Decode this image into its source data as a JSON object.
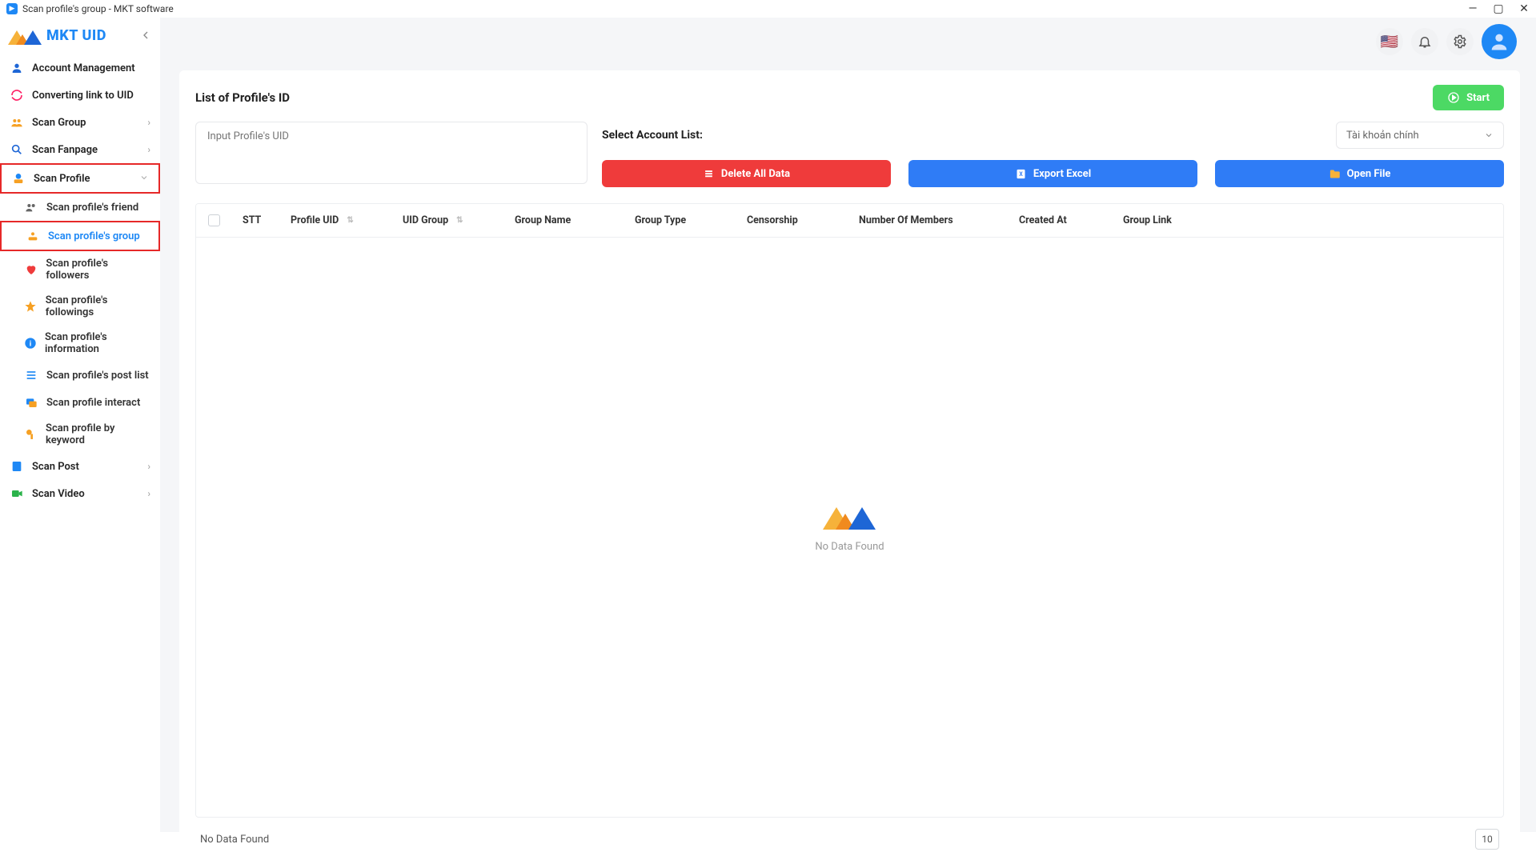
{
  "window": {
    "title": "Scan profile's group - MKT software"
  },
  "brand": {
    "name": "MKT UID"
  },
  "sidebar": {
    "items": [
      {
        "label": "Account Management"
      },
      {
        "label": "Converting link to UID"
      },
      {
        "label": "Scan Group"
      },
      {
        "label": "Scan Fanpage"
      },
      {
        "label": "Scan Profile"
      },
      {
        "label": "Scan Post"
      },
      {
        "label": "Scan Video"
      }
    ],
    "profile_sub": [
      {
        "label": "Scan profile's friend"
      },
      {
        "label": "Scan profile's group"
      },
      {
        "label": "Scan profile's followers"
      },
      {
        "label": "Scan profile's followings"
      },
      {
        "label": "Scan profile's information"
      },
      {
        "label": "Scan profile's post list"
      },
      {
        "label": "Scan profile interact"
      },
      {
        "label": "Scan profile by keyword"
      }
    ]
  },
  "main": {
    "title": "List of Profile's ID",
    "start_label": "Start",
    "uid_placeholder": "Input Profile's UID",
    "account_select_label": "Select Account List:",
    "account_select_value": "Tài khoản chính",
    "delete_label": "Delete All Data",
    "export_label": "Export Excel",
    "open_label": "Open File",
    "columns": [
      "STT",
      "Profile UID",
      "UID Group",
      "Group Name",
      "Group Type",
      "Censorship",
      "Number Of Members",
      "Created At",
      "Group Link"
    ],
    "empty_text": "No Data Found",
    "footer_text": "No Data Found",
    "page_size": "10"
  }
}
